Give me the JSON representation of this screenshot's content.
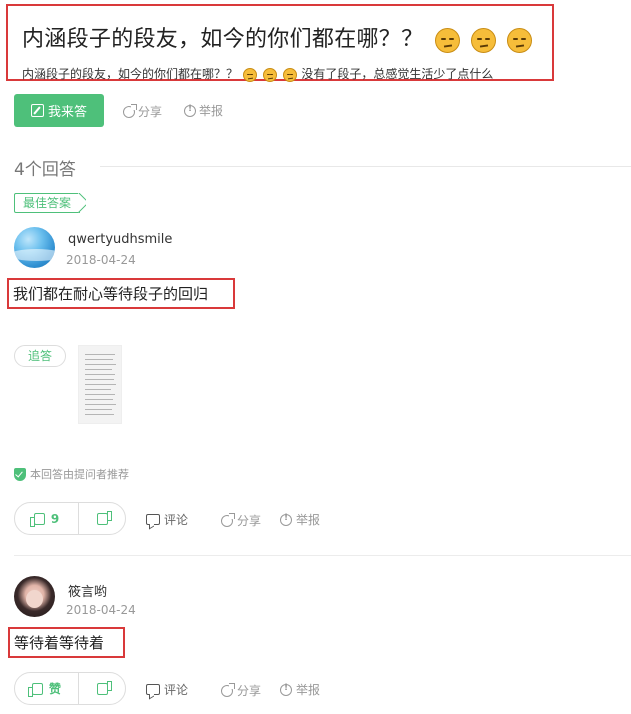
{
  "question": {
    "title": "内涵段子的段友，如今的你们都在哪？？",
    "description_before": "内涵段子的段友，如今的你们都在哪？？",
    "description_after": "没有了段子，总感觉生活少了点什么",
    "title_emoji": [
      "unamused-face-icon",
      "unamused-face-icon",
      "unamused-face-icon"
    ]
  },
  "actions": {
    "answer_label": "我来答",
    "share_label": "分享",
    "report_label": "举报"
  },
  "answers_header": {
    "count_label": "4个回答"
  },
  "answers": [
    {
      "badge": "最佳答案",
      "username": "qwertyudhsmile",
      "date": "2018-04-24",
      "text": "我们都在耐心等待段子的回归",
      "followup_label": "追答",
      "recommend_label": "本回答由提问者推荐",
      "upvote_label": "9",
      "comment_label": "评论",
      "share_label": "分享",
      "report_label": "举报"
    },
    {
      "username": "筱言哟",
      "date": "2018-04-24",
      "text": "等待着等待着",
      "upvote_label": "赞",
      "comment_label": "评论",
      "share_label": "分享",
      "report_label": "举报"
    }
  ],
  "colors": {
    "accent": "#4ec07a",
    "highlight_border": "#d9393a"
  }
}
